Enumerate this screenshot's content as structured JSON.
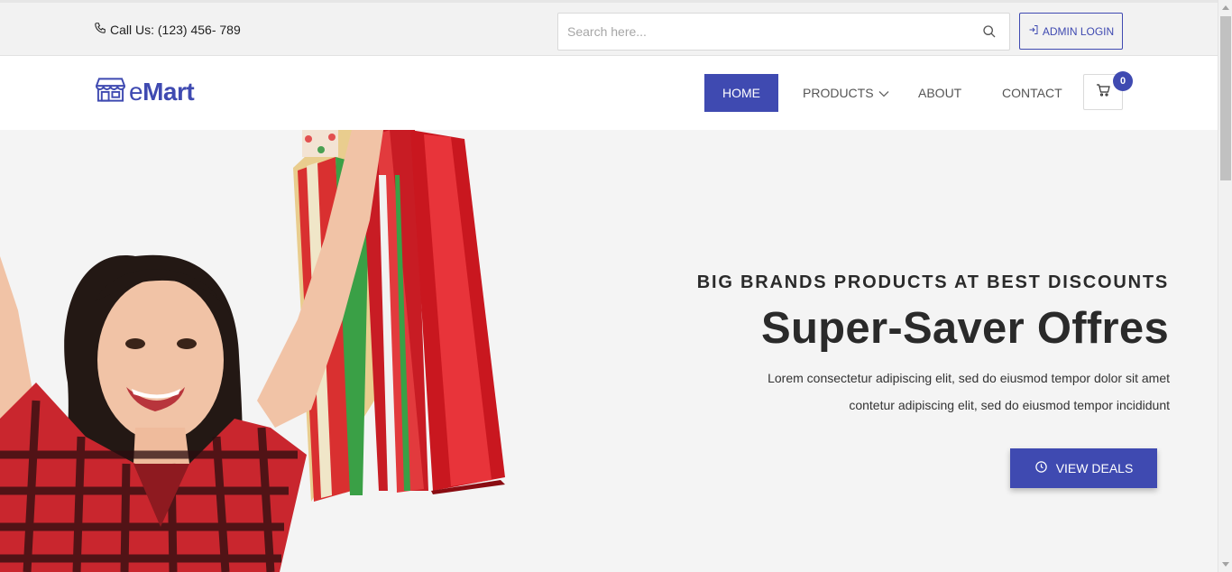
{
  "topbar": {
    "call_text": "Call Us: (123) 456- 789",
    "phone_icon": "phone-icon",
    "search": {
      "placeholder": "Search here...",
      "value": "",
      "icon": "search-icon"
    },
    "admin_login_label": "ADMIN LOGIN",
    "admin_login_icon": "login-icon"
  },
  "navbar": {
    "logo": {
      "prefix": "e",
      "name": "Mart",
      "icon": "store-icon"
    },
    "items": [
      {
        "label": "HOME",
        "active": true
      },
      {
        "label": "PRODUCTS",
        "has_dropdown": true
      },
      {
        "label": "ABOUT"
      },
      {
        "label": "CONTACT"
      }
    ],
    "cart": {
      "icon": "cart-icon",
      "count": "0"
    }
  },
  "hero": {
    "tagline": "BIG BRANDS PRODUCTS AT BEST DISCOUNTS",
    "headline": "Super-Saver Offres",
    "description_line1": "Lorem consectetur adipiscing elit, sed do eiusmod tempor dolor sit amet",
    "description_line2": "contetur adipiscing elit, sed do eiusmod tempor incididunt",
    "cta_label": "VIEW DEALS",
    "cta_icon": "clock-icon",
    "image": "woman-with-shopping-bags"
  },
  "colors": {
    "accent": "#3f4ab1",
    "topbar_bg": "#f2f2f2",
    "hero_bg": "#f4f4f4",
    "text_dark": "#2a2a2a"
  }
}
